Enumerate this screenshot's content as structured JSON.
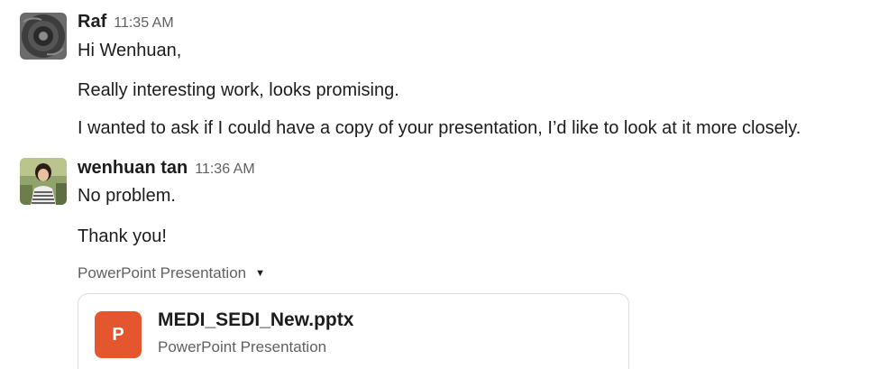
{
  "messages": [
    {
      "author": "Raf",
      "time": "11:35 AM",
      "avatar_icon": "dark-circular-texture-avatar",
      "lines": [
        "Hi Wenhuan,",
        "Really interesting work, looks promising.",
        "I wanted to ask if I could have a copy of your presentation, I’d like to look at it more closely."
      ]
    },
    {
      "author": "wenhuan tan",
      "time": "11:36 AM",
      "avatar_icon": "person-photo-avatar",
      "lines": [
        "No problem.",
        "Thank you!"
      ],
      "attachment": {
        "label": "PowerPoint Presentation",
        "icon_letter": "P",
        "file_name": "MEDI_SEDI_New.pptx",
        "file_type": "PowerPoint Presentation",
        "icon_color": "#e4572e"
      }
    }
  ]
}
